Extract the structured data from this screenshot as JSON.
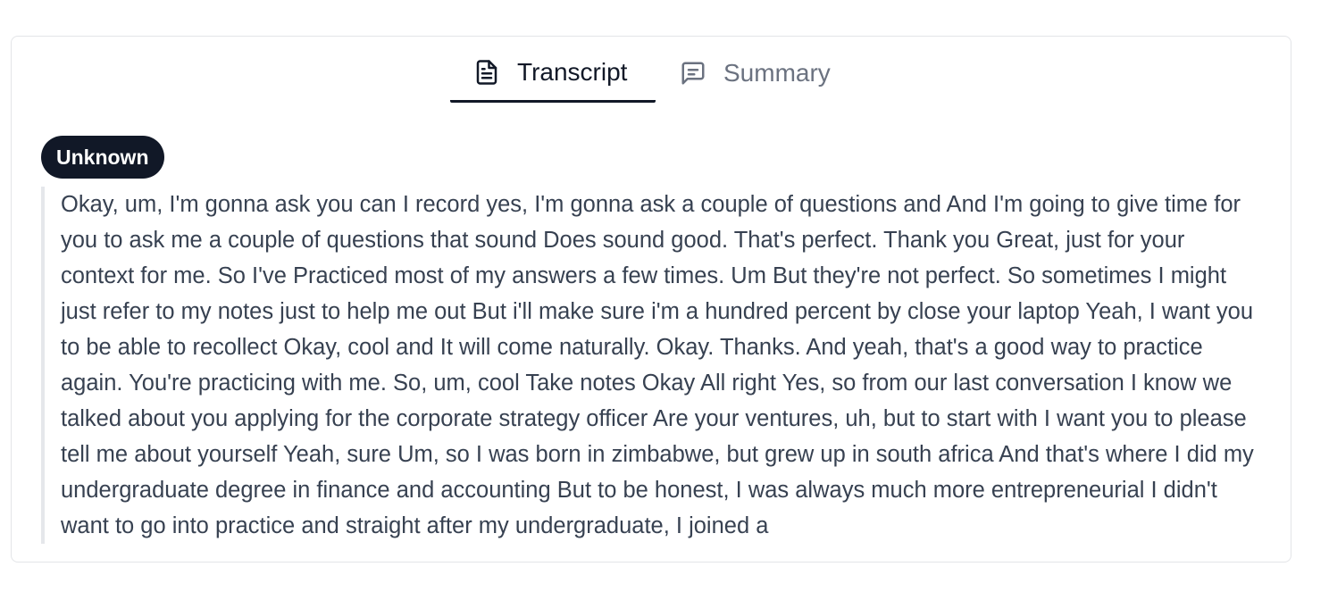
{
  "tabs": {
    "transcript": {
      "label": "Transcript",
      "icon": "document-icon"
    },
    "summary": {
      "label": "Summary",
      "icon": "message-square-icon"
    }
  },
  "speaker": {
    "label": "Unknown"
  },
  "transcript": {
    "text": "Okay, um, I'm gonna ask you can I record yes, I'm gonna ask a couple of questions and And I'm going to give time for you to ask me a couple of questions that sound Does sound good. That's perfect. Thank you Great, just for your context for me. So I've Practiced most of my answers a few times. Um But they're not perfect. So sometimes I might just refer to my notes just to help me out But i'll make sure i'm a hundred percent by close your laptop Yeah, I want you to be able to recollect Okay, cool and It will come naturally. Okay. Thanks. And yeah, that's a good way to practice again. You're practicing with me. So, um, cool Take notes Okay All right Yes, so from our last conversation I know we talked about you applying for the corporate strategy officer Are your ventures, uh, but to start with I want you to please tell me about yourself Yeah, sure Um, so I was born in zimbabwe, but grew up in south africa And that's where I did my undergraduate degree in finance and accounting But to be honest, I was always much more entrepreneurial I didn't want to go into practice and straight after my undergraduate, I joined a"
  },
  "colors": {
    "active_tab": "#111827",
    "inactive_tab": "#6b7280",
    "badge_bg": "#111827",
    "text": "#374151",
    "quote_border": "#e5e7eb",
    "card_border": "#e3e5e8"
  }
}
